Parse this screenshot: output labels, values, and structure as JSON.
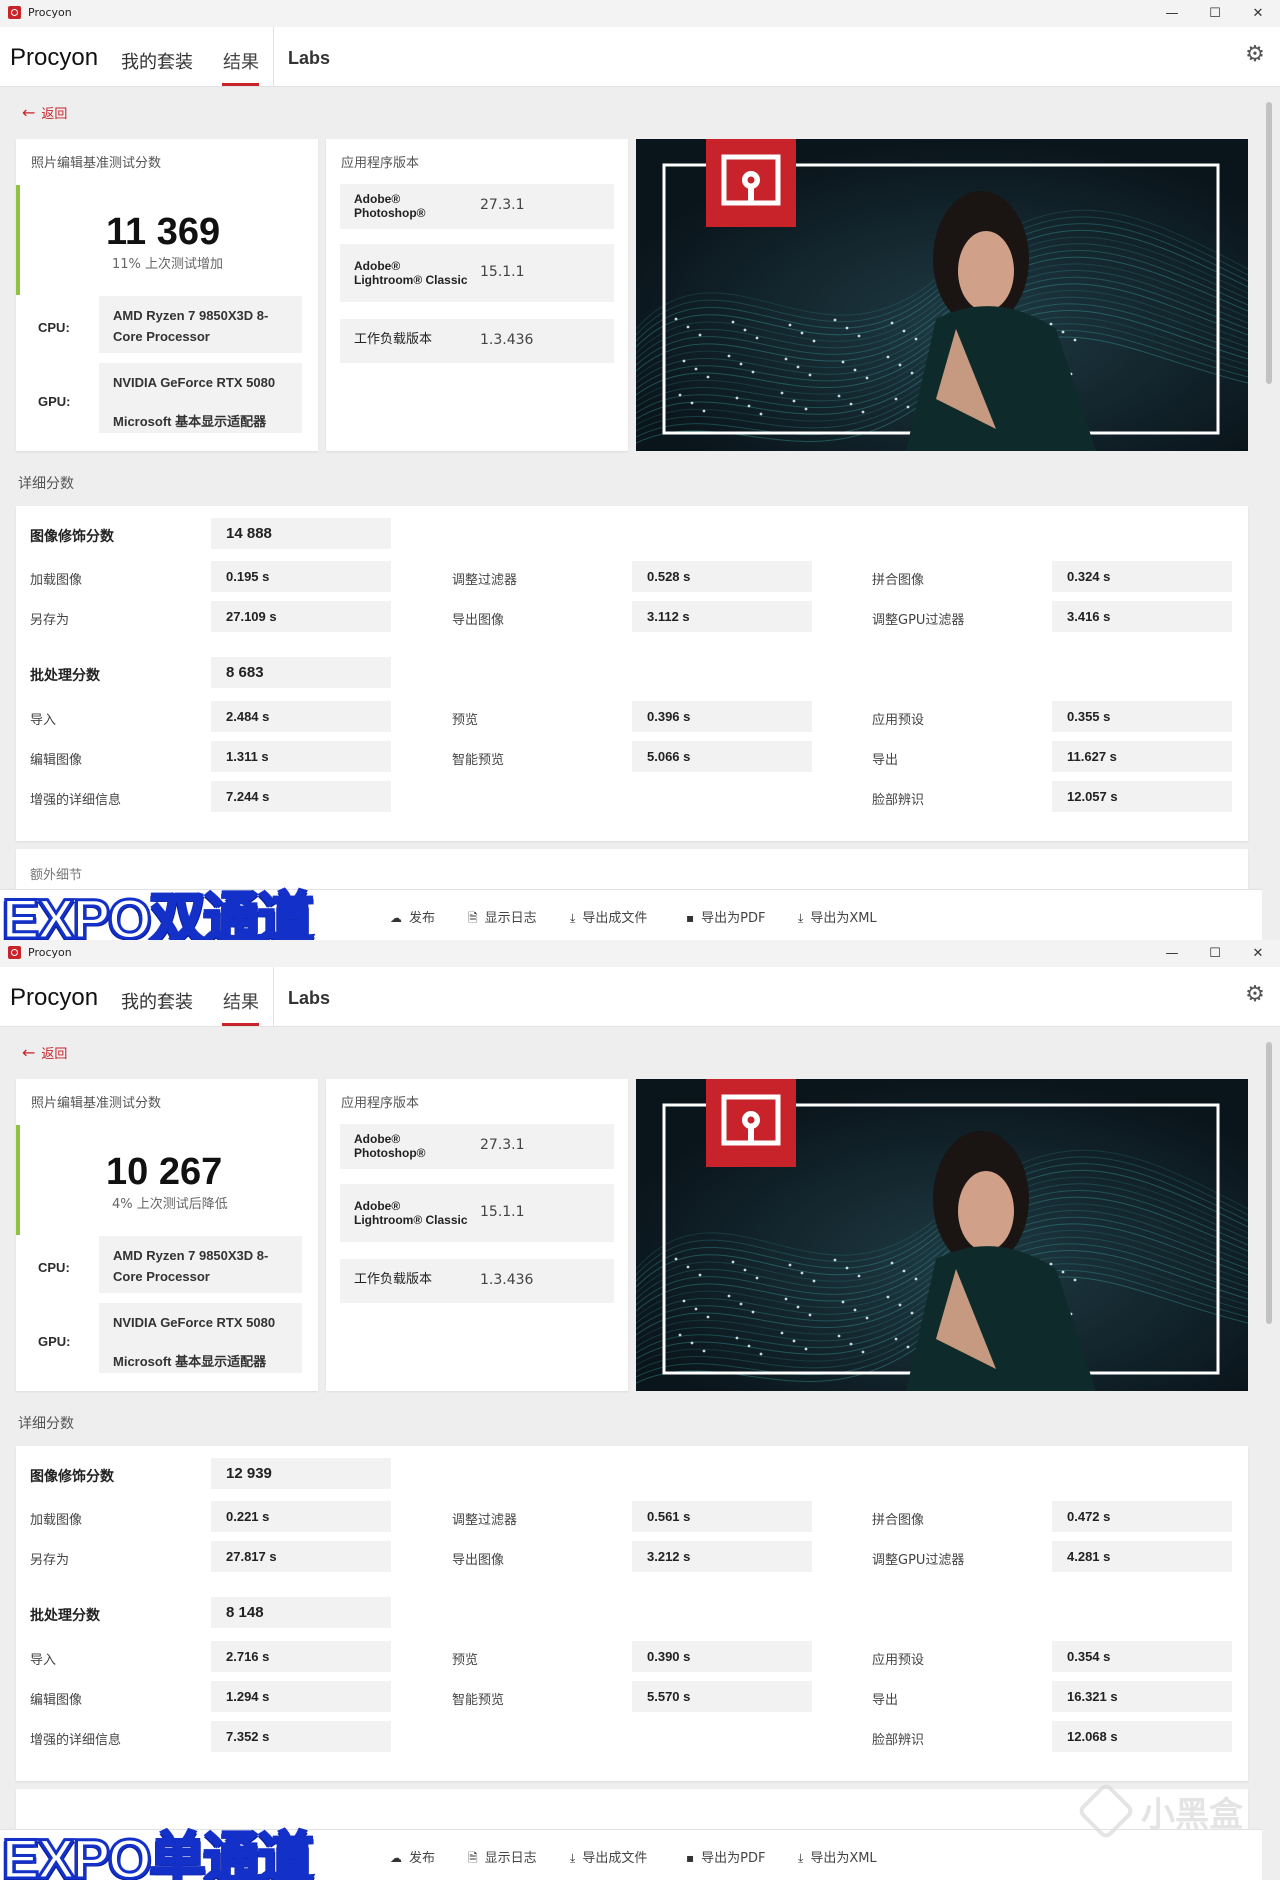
{
  "windows": [
    {
      "window_title": "Procyon",
      "brand": "Procyon",
      "tabs": [
        "我的套装",
        "结果",
        "Labs"
      ],
      "active_tab": "结果",
      "back_label": "返回",
      "score_title": "照片编辑基准测试分数",
      "score": "11 369",
      "score_change": "11% 上次测试增加",
      "cpu_label": "CPU:",
      "cpu": "AMD Ryzen 7 9850X3D 8-Core Processor",
      "gpu_label": "GPU:",
      "gpu_1": "NVIDIA GeForce RTX 5080",
      "gpu_2": "Microsoft 基本显示适配器",
      "versions_title": "应用程序版本",
      "versions": [
        {
          "name_1": "Adobe®",
          "name_2": "Photoshop®",
          "value": "27.3.1"
        },
        {
          "name_1": "Adobe®",
          "name_2": "Lightroom® Classic",
          "value": "15.1.1"
        },
        {
          "name_1": "工作负载版本",
          "name_2": "",
          "value": "1.3.436"
        }
      ],
      "detail_title": "详细分数",
      "retouch": {
        "label": "图像修饰分数",
        "score": "14 888",
        "rows": [
          [
            {
              "label": "加载图像",
              "value": "0.195 s"
            },
            {
              "label": "调整过滤器",
              "value": "0.528 s"
            },
            {
              "label": "拼合图像",
              "value": "0.324 s"
            }
          ],
          [
            {
              "label": "另存为",
              "value": "27.109 s"
            },
            {
              "label": "导出图像",
              "value": "3.112 s"
            },
            {
              "label": "调整GPU过滤器",
              "value": "3.416 s"
            }
          ]
        ]
      },
      "batch": {
        "label": "批处理分数",
        "score": "8 683",
        "rows": [
          [
            {
              "label": "导入",
              "value": "2.484 s"
            },
            {
              "label": "预览",
              "value": "0.396 s"
            },
            {
              "label": "应用预设",
              "value": "0.355 s"
            }
          ],
          [
            {
              "label": "编辑图像",
              "value": "1.311 s"
            },
            {
              "label": "智能预览",
              "value": "5.066 s"
            },
            {
              "label": "导出",
              "value": "11.627 s"
            }
          ],
          [
            {
              "label": "增强的详细信息",
              "value": "7.244 s"
            },
            null,
            {
              "label": "脸部辨识",
              "value": "12.057 s"
            }
          ]
        ]
      },
      "extra_label": "额外细节",
      "actions": [
        "发布",
        "显示日志",
        "导出成文件",
        "导出为PDF",
        "导出为XML"
      ],
      "overlay": "EXPO双通道"
    },
    {
      "window_title": "Procyon",
      "brand": "Procyon",
      "tabs": [
        "我的套装",
        "结果",
        "Labs"
      ],
      "active_tab": "结果",
      "back_label": "返回",
      "score_title": "照片编辑基准测试分数",
      "score": "10 267",
      "score_change": "4% 上次测试后降低",
      "cpu_label": "CPU:",
      "cpu": "AMD Ryzen 7 9850X3D 8-Core Processor",
      "gpu_label": "GPU:",
      "gpu_1": "NVIDIA GeForce RTX 5080",
      "gpu_2": "Microsoft 基本显示适配器",
      "versions_title": "应用程序版本",
      "versions": [
        {
          "name_1": "Adobe®",
          "name_2": "Photoshop®",
          "value": "27.3.1"
        },
        {
          "name_1": "Adobe®",
          "name_2": "Lightroom® Classic",
          "value": "15.1.1"
        },
        {
          "name_1": "工作负载版本",
          "name_2": "",
          "value": "1.3.436"
        }
      ],
      "detail_title": "详细分数",
      "retouch": {
        "label": "图像修饰分数",
        "score": "12 939",
        "rows": [
          [
            {
              "label": "加载图像",
              "value": "0.221 s"
            },
            {
              "label": "调整过滤器",
              "value": "0.561 s"
            },
            {
              "label": "拼合图像",
              "value": "0.472 s"
            }
          ],
          [
            {
              "label": "另存为",
              "value": "27.817 s"
            },
            {
              "label": "导出图像",
              "value": "3.212 s"
            },
            {
              "label": "调整GPU过滤器",
              "value": "4.281 s"
            }
          ]
        ]
      },
      "batch": {
        "label": "批处理分数",
        "score": "8 148",
        "rows": [
          [
            {
              "label": "导入",
              "value": "2.716 s"
            },
            {
              "label": "预览",
              "value": "0.390 s"
            },
            {
              "label": "应用预设",
              "value": "0.354 s"
            }
          ],
          [
            {
              "label": "编辑图像",
              "value": "1.294 s"
            },
            {
              "label": "智能预览",
              "value": "5.570 s"
            },
            {
              "label": "导出",
              "value": "16.321 s"
            }
          ],
          [
            {
              "label": "增强的详细信息",
              "value": "7.352 s"
            },
            null,
            {
              "label": "脸部辨识",
              "value": "12.068 s"
            }
          ]
        ]
      },
      "extra_label": "",
      "actions": [
        "发布",
        "显示日志",
        "导出成文件",
        "导出为PDF",
        "导出为XML"
      ],
      "overlay": "EXPO单通道"
    }
  ],
  "watermark": "小黑盒",
  "colors": {
    "accent": "#c8232a",
    "score_bar": "#8ec23f",
    "overlay_stroke": "#1330c8"
  }
}
